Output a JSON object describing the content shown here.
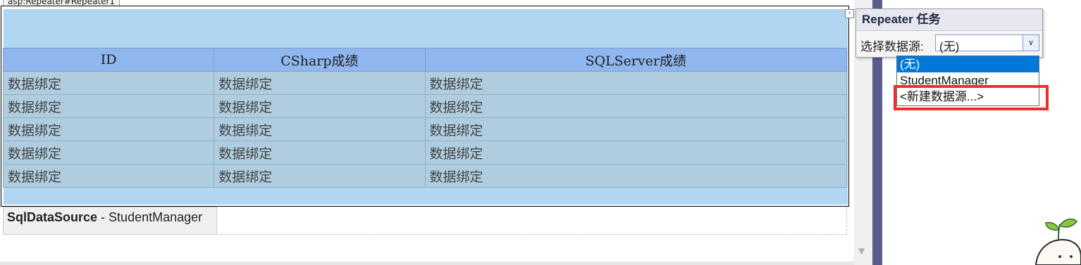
{
  "component_tag": "asp:Repeater#Repeater1",
  "table": {
    "headers": [
      "ID",
      "CSharp成绩",
      "SQLServer成绩"
    ],
    "rows": [
      [
        "数据绑定",
        "数据绑定",
        "数据绑定"
      ],
      [
        "数据绑定",
        "数据绑定",
        "数据绑定"
      ],
      [
        "数据绑定",
        "数据绑定",
        "数据绑定"
      ],
      [
        "数据绑定",
        "数据绑定",
        "数据绑定"
      ],
      [
        "数据绑定",
        "数据绑定",
        "数据绑定"
      ]
    ]
  },
  "datasource_control": {
    "type": "SqlDataSource",
    "separator": " - ",
    "name": "StudentManager"
  },
  "tasks_panel": {
    "title": "Repeater 任务",
    "choose_datasource_label": "选择数据源:",
    "selected_value": "(无)",
    "options": [
      "(无)",
      "StudentManager",
      "<新建数据源...>"
    ]
  },
  "icons": {
    "smart_tag": "smart-tag-chevron-icon",
    "dropdown": "chevron-down-icon",
    "scroll_down": "scroll-down-arrow-icon",
    "sprout": "sprout-mascot-icon"
  },
  "colors": {
    "repeater_background": "#b0d6f2",
    "header_row": "#8fb6ee",
    "data_row": "#afcddf",
    "selected_option": "#0078d7",
    "highlight": "#ee2d2d",
    "side_bar": "#5b5e8c"
  }
}
